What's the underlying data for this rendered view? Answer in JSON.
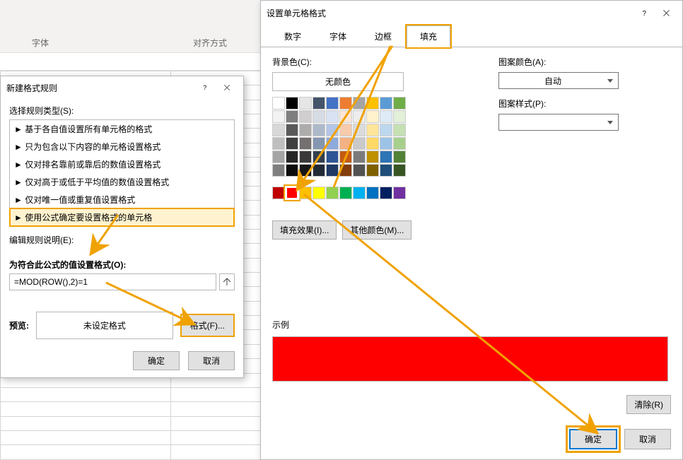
{
  "ribbon": {
    "group_font": "字体",
    "group_align": "对齐方式"
  },
  "rule_dialog": {
    "title": "新建格式规则",
    "select_type_label": "选择规则类型(S):",
    "rule_types": [
      "► 基于各自值设置所有单元格的格式",
      "► 只为包含以下内容的单元格设置格式",
      "► 仅对排名靠前或靠后的数值设置格式",
      "► 仅对高于或低于平均值的数值设置格式",
      "► 仅对唯一值或重复值设置格式",
      "► 使用公式确定要设置格式的单元格"
    ],
    "selected_rule_index": 5,
    "edit_desc_label": "编辑规则说明(E):",
    "formula_label": "为符合此公式的值设置格式(O):",
    "formula_value": "=MOD(ROW(),2)=1",
    "preview_label": "预览:",
    "preview_text": "未设定格式",
    "format_button": "格式(F)...",
    "ok": "确定",
    "cancel": "取消"
  },
  "format_dialog": {
    "title": "设置单元格格式",
    "tabs": [
      "数字",
      "字体",
      "边框",
      "填充"
    ],
    "active_tab_index": 3,
    "bgcolor_label": "背景色(C):",
    "nocolor": "无颜色",
    "fill_effects": "填充效果(I)...",
    "other_colors": "其他颜色(M)...",
    "pattern_color_label": "图案颜色(A):",
    "pattern_color_value": "自动",
    "pattern_style_label": "图案样式(P):",
    "pattern_style_value": "",
    "theme_colors": [
      [
        "#ffffff",
        "#000000",
        "#e7e6e6",
        "#44546a",
        "#4472c4",
        "#ed7d31",
        "#a5a5a5",
        "#ffc000",
        "#5b9bd5",
        "#70ad47"
      ],
      [
        "#f2f2f2",
        "#7f7f7f",
        "#d0cece",
        "#d6dce4",
        "#d9e2f3",
        "#fbe5d5",
        "#ededed",
        "#fff2cc",
        "#deebf6",
        "#e2efd9"
      ],
      [
        "#d8d8d8",
        "#595959",
        "#aeabab",
        "#adb9ca",
        "#b4c6e7",
        "#f7cbac",
        "#dbdbdb",
        "#fee599",
        "#bdd7ee",
        "#c5e0b3"
      ],
      [
        "#bfbfbf",
        "#3f3f3f",
        "#757070",
        "#8496b0",
        "#8eaadb",
        "#f4b183",
        "#c9c9c9",
        "#ffd965",
        "#9cc3e5",
        "#a8d08d"
      ],
      [
        "#a5a5a5",
        "#262626",
        "#3a3838",
        "#323f4f",
        "#2f5496",
        "#c55a11",
        "#7b7b7b",
        "#bf9000",
        "#2e75b5",
        "#538135"
      ],
      [
        "#7f7f7f",
        "#0c0c0c",
        "#171616",
        "#222a35",
        "#1f3864",
        "#833c0b",
        "#525252",
        "#7f6000",
        "#1e4e79",
        "#375623"
      ]
    ],
    "standard_colors": [
      "#c00000",
      "#ff0000",
      "#ffc000",
      "#ffff00",
      "#92d050",
      "#00b050",
      "#00b0f0",
      "#0070c0",
      "#002060",
      "#7030a0"
    ],
    "selected_standard_index": 1,
    "example_label": "示例",
    "example_fill": "#ff0000",
    "clear": "清除(R)",
    "ok": "确定",
    "cancel": "取消"
  }
}
